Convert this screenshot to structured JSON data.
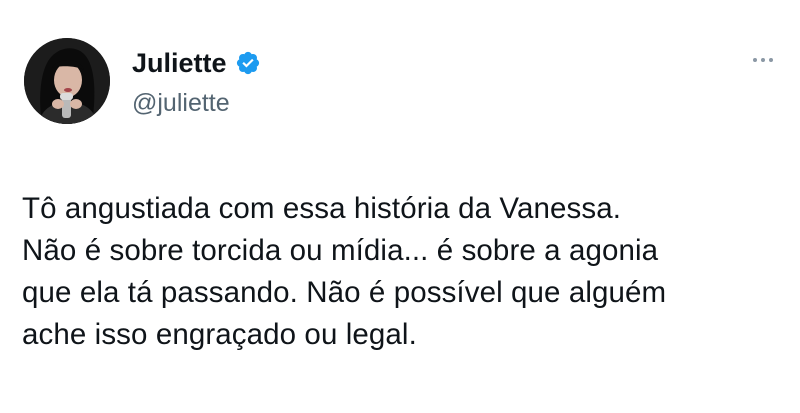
{
  "author": {
    "display_name": "Juliette",
    "handle": "@juliette",
    "verified": true,
    "avatar_icon": "profile-photo",
    "verified_color": "#1d9bf0"
  },
  "menu": {
    "icon": "more-horizontal-icon"
  },
  "tweet": {
    "lines": [
      "Tô angustiada com essa história da Vanessa.",
      "Não é sobre torcida ou mídia... é sobre a agonia",
      "que ela tá passando. Não é possível que alguém",
      "ache isso engraçado ou legal."
    ]
  }
}
